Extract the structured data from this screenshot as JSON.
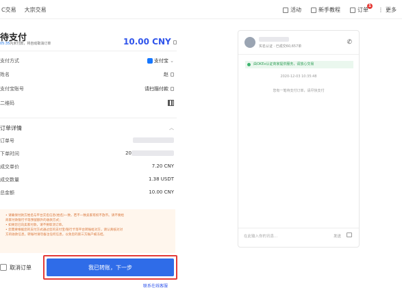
{
  "topbar": {
    "left_items": [
      "C交易",
      "大宗交易"
    ],
    "right_items": [
      "活动",
      "新手教程",
      "订单",
      "更多"
    ],
    "order_badge": "1"
  },
  "order": {
    "status_title": "待支付",
    "countdown": "05:35",
    "countdown_suffix": "内未付款，将自动取消订单",
    "amount": "10.00 CNY"
  },
  "payment": {
    "rows": [
      {
        "label": "支付方式",
        "value": "支付宝"
      },
      {
        "label": "姓名",
        "value": "赵"
      },
      {
        "label": "支付宝账号",
        "value": "请扫描付款"
      },
      {
        "label": "二维码",
        "value": ""
      }
    ]
  },
  "details": {
    "title": "订单详情",
    "rows": [
      {
        "label": "订单号",
        "value": ""
      },
      {
        "label": "下单时间",
        "value": "20"
      },
      {
        "label": "成交单价",
        "value": "7.20 CNY"
      },
      {
        "label": "成交数量",
        "value": "1.38 USDT"
      },
      {
        "label": "总金额",
        "value": "10.00 CNY"
      }
    ]
  },
  "warning": {
    "lines": [
      "• 请确保付款方姓名与平台实名信息(姓名)一致，若不一致卖家有权不放币。请不要给",
      "  商家付款银行卡等预留额外的收款方式；",
      "• 如果您已向卖家付款，请不要取消订单。",
      "• 您需要根据您的支付方式通过您的支付宝/银行卡等平台转账给对方，请认真核对对",
      "  方的收款信息，转账时请勿备注任何信息，以免您的第三方账户被冻结。"
    ]
  },
  "actions": {
    "cancel": "取消订单",
    "confirm": "我已转账，下一步",
    "contact": "联系在线客服"
  },
  "chat": {
    "verified": "实名认证",
    "trades": "已成交60,657单",
    "notice": "由OKEx认证商家提供服务，请放心交易",
    "timestamp": "2020-12-03 10:35:48",
    "system_msg": "您有一笔待支付订单，请尽快支付",
    "input_placeholder": "在此输入你的讯息...",
    "send": "发送"
  },
  "colors": {
    "primary": "#2f6ce8",
    "highlight_border": "#e53935",
    "warning_bg": "#fff6ed",
    "warning_text": "#d9763a",
    "notice_bg": "#eaf7ee"
  }
}
